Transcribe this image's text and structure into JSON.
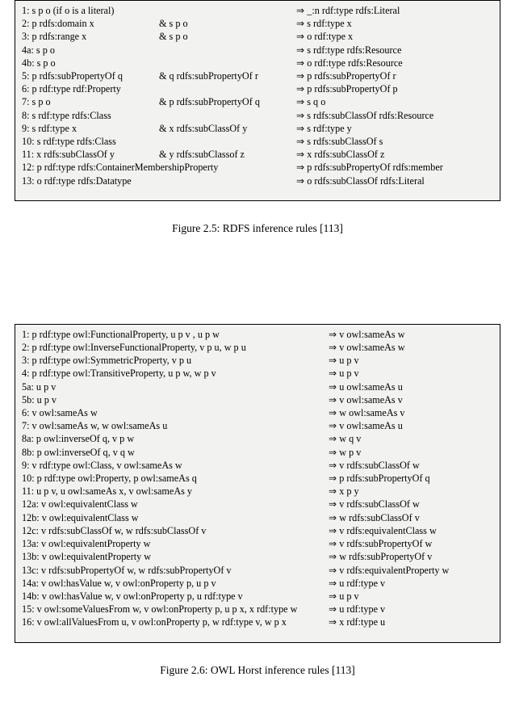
{
  "figure1": {
    "caption": "Figure 2.5: RDFS inference rules [113]",
    "rules": [
      {
        "num": "1:",
        "p1": "s p o (if o is a literal)",
        "p2": "",
        "c": "_:n rdf:type rdfs:Literal"
      },
      {
        "num": "2:",
        "p1": "p rdfs:domain x",
        "p2": "& s p o",
        "c": "s rdf:type x"
      },
      {
        "num": "3:",
        "p1": "p rdfs:range x",
        "p2": "& s p o",
        "c": "o rdf:type x"
      },
      {
        "num": "4a:",
        "p1": "s p o",
        "p2": "",
        "c": "s rdf:type rdfs:Resource"
      },
      {
        "num": "4b:",
        "p1": "s p o",
        "p2": "",
        "c": "o rdf:type rdfs:Resource"
      },
      {
        "num": "5:",
        "p1": "p rdfs:subPropertyOf q",
        "p2": "& q rdfs:subPropertyOf r",
        "c": "p rdfs:subPropertyOf r"
      },
      {
        "num": "6:",
        "p1": "p rdf:type rdf:Property",
        "p2": "",
        "c": "p rdfs:subPropertyOf p"
      },
      {
        "num": "7:",
        "p1": "s p o",
        "p2": "& p rdfs:subPropertyOf q",
        "c": "s q o"
      },
      {
        "num": "8:",
        "p1": "s rdf:type rdfs:Class",
        "p2": "",
        "c": "s rdfs:subClassOf rdfs:Resource"
      },
      {
        "num": "9:",
        "p1": "s rdf:type x",
        "p2": "& x rdfs:subClassOf y",
        "c": "s rdf:type y"
      },
      {
        "num": "10:",
        "p1": "s rdf:type rdfs:Class",
        "p2": "",
        "c": "s rdfs:subClassOf s"
      },
      {
        "num": "11:",
        "p1": "x rdfs:subClassOf y",
        "p2": "& y rdfs:subClassof z",
        "c": "x rdfs:subClassOf z"
      },
      {
        "num": "12:",
        "p1w": "p rdf:type rdfs:ContainerMembershipProperty",
        "c": "p rdfs:subPropertyOf rdfs:member"
      },
      {
        "num": "13:",
        "p1": "o rdf:type rdfs:Datatype",
        "p2": "",
        "c": "o rdfs:subClassOf rdfs:Literal"
      }
    ]
  },
  "figure2": {
    "caption": "Figure 2.6: OWL Horst inference rules [113]",
    "rules": [
      {
        "num": "1:",
        "p": "p rdf:type owl:FunctionalProperty, u p v , u p w",
        "c": "v owl:sameAs w"
      },
      {
        "num": "2:",
        "p": "p rdf:type owl:InverseFunctionalProperty, v p u, w p u",
        "c": "v owl:sameAs w"
      },
      {
        "num": "3:",
        "p": "p rdf:type owl:SymmetricProperty, v p u",
        "c": "u p v"
      },
      {
        "num": "4:",
        "p": "p rdf:type owl:TransitiveProperty, u p w, w p v",
        "c": "u p v"
      },
      {
        "num": "5a:",
        "p": "u p v",
        "c": "u owl:sameAs u"
      },
      {
        "num": "5b:",
        "p": "u p v",
        "c": "v owl:sameAs v"
      },
      {
        "num": "6:",
        "p": "v owl:sameAs w",
        "c": "w owl:sameAs v"
      },
      {
        "num": "7:",
        "p": "v owl:sameAs w, w owl:sameAs u",
        "c": "v owl:sameAs u"
      },
      {
        "num": "8a:",
        "p": "p owl:inverseOf q, v p w",
        "c": "w q v"
      },
      {
        "num": "8b:",
        "p": "p owl:inverseOf q, v q w",
        "c": "w p v"
      },
      {
        "num": "9:",
        "p": "v rdf:type owl:Class, v owl:sameAs w",
        "c": "v rdfs:subClassOf w"
      },
      {
        "num": "10:",
        "p": "p rdf:type owl:Property, p owl:sameAs q",
        "c": "p rdfs:subPropertyOf q"
      },
      {
        "num": "11:",
        "p": "u p v, u owl:sameAs x, v owl:sameAs y",
        "c": "x p y"
      },
      {
        "num": "12a:",
        "p": "v owl:equivalentClass w",
        "c": "v rdfs:subClassOf w"
      },
      {
        "num": "12b:",
        "p": "v owl:equivalentClass w",
        "c": "w rdfs:subClassOf v"
      },
      {
        "num": "12c:",
        "p": "v rdfs:subClassOf w, w rdfs:subClassOf v",
        "c": "v rdfs:equivalentClass w"
      },
      {
        "num": "13a:",
        "p": "v owl:equivalentProperty w",
        "c": "v rdfs:subPropertyOf w"
      },
      {
        "num": "13b:",
        "p": "v owl:equivalentProperty w",
        "c": "w rdfs:subPropertyOf v"
      },
      {
        "num": "13c:",
        "p": "v rdfs:subPropertyOf w, w rdfs:subPropertyOf v",
        "c": "v rdfs:equivalentProperty w"
      },
      {
        "num": "14a:",
        "p": "v owl:hasValue w, v owl:onProperty p, u p v",
        "c": "u rdf:type v"
      },
      {
        "num": "14b:",
        "p": "v owl:hasValue w, v owl:onProperty p, u rdf:type v",
        "c": "u p v"
      },
      {
        "num": "15:",
        "p": "v owl:someValuesFrom w, v owl:onProperty p, u p x, x rdf:type w",
        "c": "u rdf:type v"
      },
      {
        "num": "16:",
        "p": "v owl:allValuesFrom u, v owl:onProperty p, w rdf:type v, w p x",
        "c": "x rdf:type u"
      }
    ]
  }
}
